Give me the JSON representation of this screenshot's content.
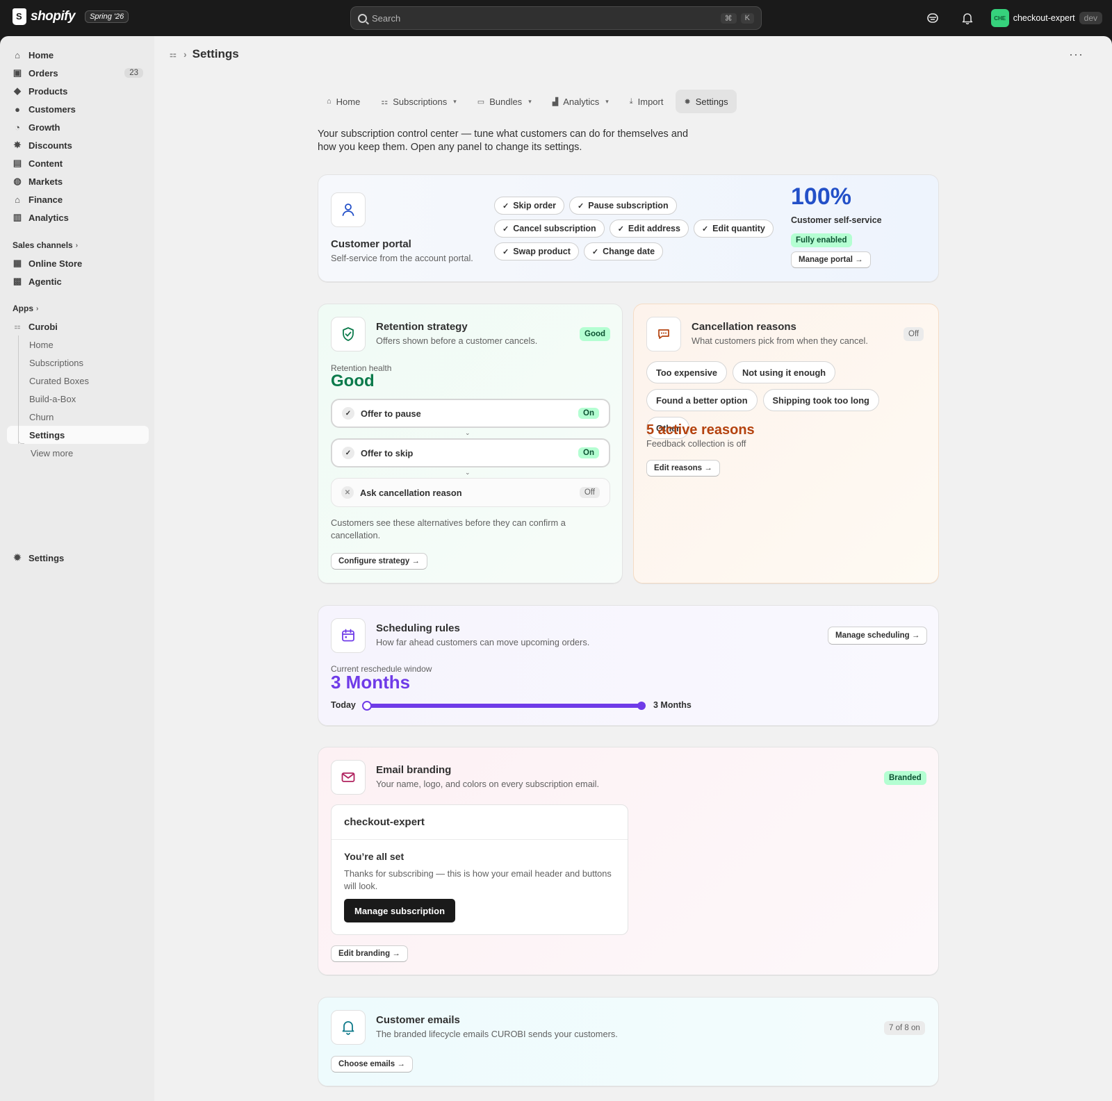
{
  "topbar": {
    "logo_text": "shopify",
    "edition": "Spring '26",
    "search_placeholder": "Search",
    "shortcut_key1": "⌘",
    "shortcut_key2": "K",
    "store_initials": "CHE",
    "store_name": "checkout-expert",
    "store_env": "dev"
  },
  "sidebar": {
    "items": [
      {
        "label": "Home",
        "icon": "home-icon"
      },
      {
        "label": "Orders",
        "icon": "orders-icon",
        "count": "23"
      },
      {
        "label": "Products",
        "icon": "tag-icon"
      },
      {
        "label": "Customers",
        "icon": "person-icon"
      },
      {
        "label": "Growth",
        "icon": "gauge-icon"
      },
      {
        "label": "Discounts",
        "icon": "discount-icon"
      },
      {
        "label": "Content",
        "icon": "content-icon"
      },
      {
        "label": "Markets",
        "icon": "globe-icon"
      },
      {
        "label": "Finance",
        "icon": "bank-icon"
      },
      {
        "label": "Analytics",
        "icon": "bar-chart-icon"
      }
    ],
    "sales_channels_label": "Sales channels",
    "channels": [
      {
        "label": "Online Store",
        "icon": "store-icon"
      },
      {
        "label": "Agentic",
        "icon": "agentic-icon"
      }
    ],
    "apps_label": "Apps",
    "app_name": "Curobi",
    "app_items": [
      "Home",
      "Subscriptions",
      "Curated Boxes",
      "Build-a-Box",
      "Churn",
      "Settings"
    ],
    "view_more": "View more",
    "settings_label": "Settings"
  },
  "page": {
    "title": "Settings",
    "tabs": [
      {
        "label": "Home",
        "icon": "home-icon",
        "dropdown": false
      },
      {
        "label": "Subscriptions",
        "icon": "subscriptions-icon",
        "dropdown": true
      },
      {
        "label": "Bundles",
        "icon": "box-icon",
        "dropdown": true
      },
      {
        "label": "Analytics",
        "icon": "analytics-icon",
        "dropdown": true
      },
      {
        "label": "Import",
        "icon": "import-icon",
        "dropdown": false
      },
      {
        "label": "Settings",
        "icon": "gear-icon",
        "dropdown": false,
        "active": true
      }
    ],
    "intro": "Your subscription control center — tune what customers can do for themselves and how you keep them. Open any panel to change its settings."
  },
  "portal": {
    "title": "Customer portal",
    "subtitle": "Self-service from the account portal.",
    "actions": [
      "Skip order",
      "Pause subscription",
      "Cancel subscription",
      "Edit address",
      "Edit quantity",
      "Swap product",
      "Change date"
    ],
    "percent": "100%",
    "percent_label": "Customer self-service",
    "status": "Fully enabled",
    "button": "Manage portal →"
  },
  "retention": {
    "title": "Retention strategy",
    "subtitle": "Offers shown before a customer cancels.",
    "badge": "Good",
    "health_label": "Retention health",
    "health_value": "Good",
    "steps": [
      {
        "label": "Offer to pause",
        "status": "On",
        "enabled": true
      },
      {
        "label": "Offer to skip",
        "status": "On",
        "enabled": true
      },
      {
        "label": "Ask cancellation reason",
        "status": "Off",
        "enabled": false
      }
    ],
    "note": "Customers see these alternatives before they can confirm a cancellation.",
    "button": "Configure strategy →"
  },
  "cancellation": {
    "title": "Cancellation reasons",
    "subtitle": "What customers pick from when they cancel.",
    "badge": "Off",
    "reasons": [
      "Too expensive",
      "Not using it enough",
      "Found a better option",
      "Shipping took too long",
      "Other"
    ],
    "count_text": "5 active reasons",
    "feedback": "Feedback collection is off",
    "button": "Edit reasons →"
  },
  "scheduling": {
    "title": "Scheduling rules",
    "subtitle": "How far ahead customers can move upcoming orders.",
    "button": "Manage scheduling →",
    "window_label": "Current reschedule window",
    "window_value": "3 Months",
    "range_start": "Today",
    "range_end": "3 Months",
    "slider_fill": 1.0
  },
  "branding": {
    "title": "Email branding",
    "subtitle": "Your name, logo, and colors on every subscription email.",
    "badge": "Branded",
    "preview_store": "checkout-expert",
    "preview_heading": "You’re all set",
    "preview_body": "Thanks for subscribing — this is how your email header and buttons will look.",
    "preview_button": "Manage subscription",
    "button": "Edit branding →"
  },
  "emails": {
    "title": "Customer emails",
    "subtitle": "The branded lifecycle emails CUROBI sends your customers.",
    "badge": "7 of 8 on",
    "button": "Choose emails →"
  },
  "colors": {
    "retention_accent": "#0b7a4b",
    "cancel_accent": "#b4420e",
    "schedule_accent": "#6f3be8",
    "portal_accent": "#2350c8",
    "branding_accent": "#b0225f",
    "emails_accent": "#0f7a8a"
  }
}
